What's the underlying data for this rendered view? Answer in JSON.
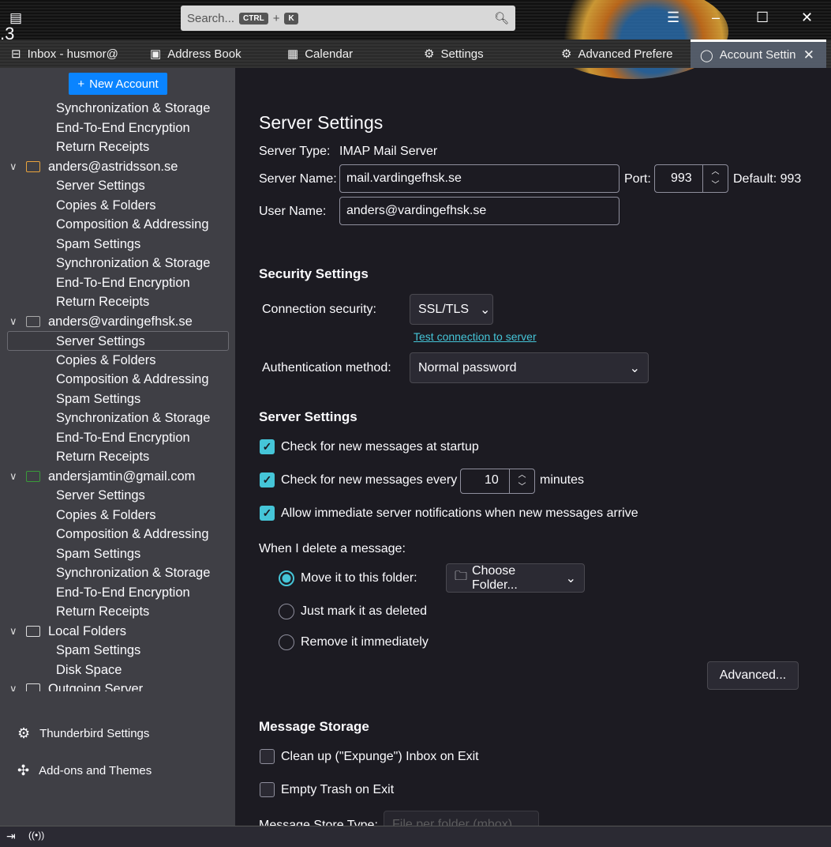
{
  "titlebar": {
    "search_placeholder": "Search...",
    "kbd_ctrl": "CTRL",
    "kbd_plus": "+",
    "kbd_k": "K",
    "stray_text": ".3"
  },
  "tabs": [
    {
      "label": "Inbox - husmor@",
      "icon": "inbox-icon"
    },
    {
      "label": "Address Book",
      "icon": "address-book-icon"
    },
    {
      "label": "Calendar",
      "icon": "calendar-icon"
    },
    {
      "label": "Settings",
      "icon": "gear-icon"
    },
    {
      "label": "Advanced Prefere",
      "icon": "gear-icon"
    },
    {
      "label": "Account Settin",
      "icon": "account-icon",
      "active": true
    }
  ],
  "sidebar": {
    "new_account": "New Account",
    "rows": [
      {
        "t": "sub",
        "label": "Synchronization & Storage"
      },
      {
        "t": "sub",
        "label": "End-To-End Encryption"
      },
      {
        "t": "sub",
        "label": "Return Receipts"
      },
      {
        "t": "acct",
        "label": "anders@astridsson.se",
        "color": "#e8a33d"
      },
      {
        "t": "sub",
        "label": "Server Settings"
      },
      {
        "t": "sub",
        "label": "Copies & Folders"
      },
      {
        "t": "sub",
        "label": "Composition & Addressing"
      },
      {
        "t": "sub",
        "label": "Spam Settings"
      },
      {
        "t": "sub",
        "label": "Synchronization & Storage"
      },
      {
        "t": "sub",
        "label": "End-To-End Encryption"
      },
      {
        "t": "sub",
        "label": "Return Receipts"
      },
      {
        "t": "acct",
        "label": "anders@vardingefhsk.se",
        "color": "#aaaaaa"
      },
      {
        "t": "sel",
        "label": "Server Settings"
      },
      {
        "t": "sub",
        "label": "Copies & Folders"
      },
      {
        "t": "sub",
        "label": "Composition & Addressing"
      },
      {
        "t": "sub",
        "label": "Spam Settings"
      },
      {
        "t": "sub",
        "label": "Synchronization & Storage"
      },
      {
        "t": "sub",
        "label": "End-To-End Encryption"
      },
      {
        "t": "sub",
        "label": "Return Receipts"
      },
      {
        "t": "acct",
        "label": "andersjamtin@gmail.com",
        "color": "#3a9a3a"
      },
      {
        "t": "sub",
        "label": "Server Settings"
      },
      {
        "t": "sub",
        "label": "Copies & Folders"
      },
      {
        "t": "sub",
        "label": "Composition & Addressing"
      },
      {
        "t": "sub",
        "label": "Spam Settings"
      },
      {
        "t": "sub",
        "label": "Synchronization & Storage"
      },
      {
        "t": "sub",
        "label": "End-To-End Encryption"
      },
      {
        "t": "sub",
        "label": "Return Receipts"
      },
      {
        "t": "acct",
        "label": "Local Folders",
        "color": "#dddddd"
      },
      {
        "t": "sub",
        "label": "Spam Settings"
      },
      {
        "t": "sub",
        "label": "Disk Space"
      },
      {
        "t": "acct",
        "label": "Outgoing Server",
        "color": "#dddddd"
      }
    ],
    "thunderbird_settings": "Thunderbird Settings",
    "addons": "Add-ons and Themes"
  },
  "main": {
    "title": "Server Settings",
    "server_type_label": "Server Type:",
    "server_type": "IMAP Mail Server",
    "server_name_label": "Server Name:",
    "server_name": "mail.vardingefhsk.se",
    "port_label": "Port:",
    "port": "993",
    "default_port": "Default: 993",
    "user_name_label": "User Name:",
    "user_name": "anders@vardingefhsk.se",
    "security_heading": "Security Settings",
    "conn_sec_label": "Connection security:",
    "conn_sec": "SSL/TLS",
    "test_link": "Test connection to server",
    "auth_label": "Authentication method:",
    "auth": "Normal password",
    "server_heading": "Server Settings",
    "check_startup": "Check for new messages at startup",
    "check_every": "Check for new messages every",
    "check_minutes": "10",
    "minutes": "minutes",
    "allow_notif": "Allow immediate server notifications when new messages arrive",
    "delete_label": "When I delete a message:",
    "move_folder": "Move it to this folder:",
    "choose_folder": "Choose Folder...",
    "mark_deleted": "Just mark it as deleted",
    "remove_immediately": "Remove it immediately",
    "advanced": "Advanced...",
    "storage_heading": "Message Storage",
    "expunge": "Clean up (\"Expunge\") Inbox on Exit",
    "empty_trash": "Empty Trash on Exit",
    "store_type_label": "Message Store Type:",
    "store_type": "File per folder (mbox)"
  },
  "colors": {
    "accent": "#45c5d8",
    "button": "#0a84ff",
    "link": "#45c5d8"
  }
}
